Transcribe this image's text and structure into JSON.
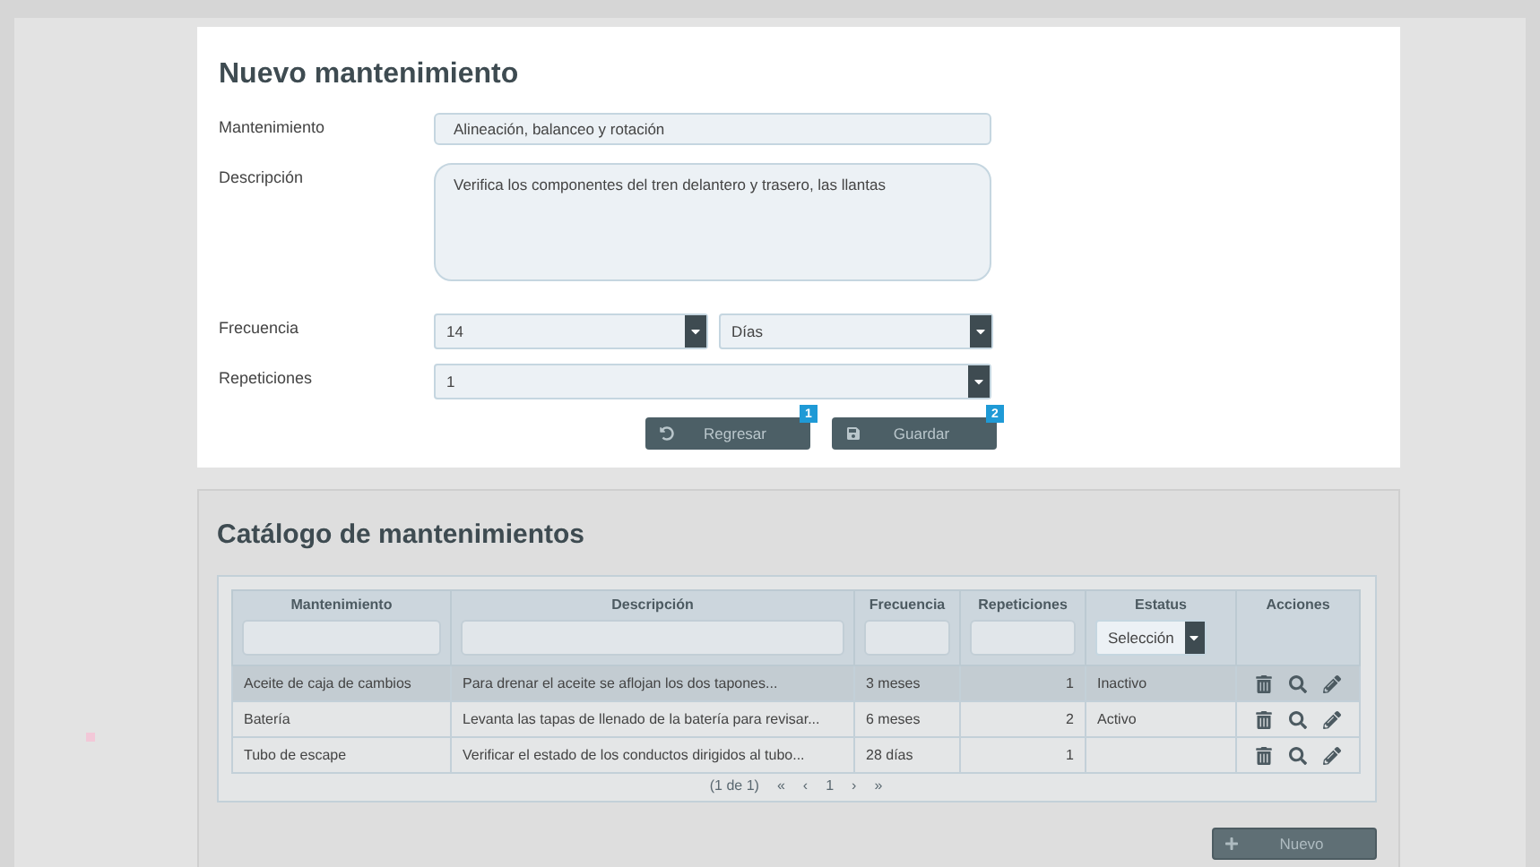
{
  "form": {
    "title": "Nuevo mantenimiento",
    "fields": [
      {
        "kind": "text",
        "label": "Mantenimiento",
        "value": "Alineación, balanceo y rotación"
      },
      {
        "kind": "textarea",
        "label": "Descripción",
        "value": "Verifica los componentes del tren delantero y trasero, las llantas"
      },
      {
        "kind": "pair",
        "label": "Frecuencia",
        "values": [
          "14",
          "Días"
        ]
      },
      {
        "kind": "select",
        "label": "Repeticiones",
        "value": "1"
      }
    ],
    "buttons": [
      {
        "kind": "back",
        "label": "Regresar",
        "badge": "1"
      },
      {
        "kind": "save",
        "label": "Guardar",
        "badge": "2"
      }
    ]
  },
  "catalog": {
    "title": "Catálogo de mantenimientos",
    "columns": [
      {
        "label": "Mantenimiento",
        "kind": "text"
      },
      {
        "label": "Descripción",
        "kind": "text"
      },
      {
        "label": "Frecuencia",
        "kind": "text"
      },
      {
        "label": "Repeticiones",
        "kind": "text"
      },
      {
        "label": "Estatus",
        "kind": "select",
        "placeholder": "Selección"
      },
      {
        "label": "Acciones",
        "kind": "actions"
      }
    ],
    "rows": [
      {
        "name": "Aceite de caja de cambios",
        "description": "Para drenar el aceite se aflojan los dos tapones...",
        "frequency": "3 meses",
        "repetitions": "1",
        "status": "Inactivo",
        "selected": true
      },
      {
        "name": "Batería",
        "description": "Levanta las tapas de llenado de la batería para revisar...",
        "frequency": "6 meses",
        "repetitions": "2",
        "status": "Activo",
        "selected": false
      },
      {
        "name": "Tubo de escape",
        "description": "Verificar el estado de los conductos dirigidos al tubo...",
        "frequency": "28 días",
        "repetitions": "1",
        "selected": false
      }
    ],
    "pagination": {
      "summary": "(1 de 1)",
      "first": "«",
      "prev": "‹",
      "page": "1",
      "next": "›",
      "last": "»"
    },
    "new_button": {
      "label": "Nuevo"
    }
  }
}
